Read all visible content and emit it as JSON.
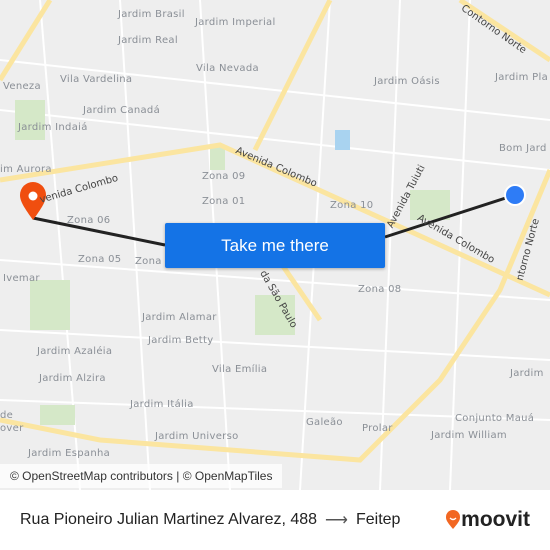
{
  "map": {
    "neighborhoods": [
      "Jardim Brasil",
      "Jardim Imperial",
      "Jardim Real",
      "Vila Nevada",
      "Vila Vardelina",
      "Veneza",
      "Jardim Canadá",
      "Jardim Indaiá",
      "Jardim Oásis",
      "Jardim Pla",
      "Bom Jard",
      "im Aurora",
      "Zona 09",
      "Zona 01",
      "Zona 10",
      "Zona 06",
      "Zona 05",
      "Zona",
      "Zona 08",
      "Ivemar",
      "Jardim Alamar",
      "Jardim Azaléia",
      "Jardim Betty",
      "Jardim Alzira",
      "Vila Emília",
      "Jardim Itália",
      "Jardim Universo",
      "Galeão",
      "Prolar",
      "Conjunto Mauá",
      "Jardim William",
      "Jardim Espanha",
      "Jardim",
      "de",
      "over"
    ],
    "roads": [
      "Avenida Colombo",
      "venida Colombo",
      "Avenida Colombo",
      "Avenida Tuiuti",
      "Contorno Norte",
      "ntorno Norte",
      "da São Paulo"
    ],
    "origin_color": "#2e7cf6",
    "destination_color": "#f04e0f",
    "route_color": "#222222"
  },
  "cta": {
    "label": "Take me there"
  },
  "attribution": "© OpenStreetMap contributors | © OpenMapTiles",
  "footer": {
    "origin": "Rua Pioneiro Julian Martinez Alvarez, 488",
    "arrow": "⟶",
    "destination": "Feitep"
  },
  "brand": {
    "name": "moovit",
    "color": "#f26722"
  }
}
